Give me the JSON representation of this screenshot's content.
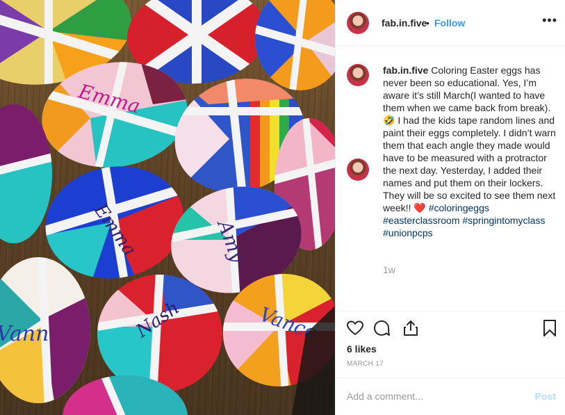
{
  "post": {
    "username": "fab.in.five",
    "separator": "•",
    "follow_label": "Follow",
    "more_icon": "more-options-icon",
    "caption_user": "fab.in.five",
    "caption_part1": " Coloring Easter eggs has never been so educational. Yes, I’m aware it’s still March(I wanted to have them when we came back from break).",
    "caption_emoji": "🤣",
    "caption_part2": " I had the kids tape random lines and paint their eggs completely. I didn’t warn them that each angle they made would have to be measured with a protractor the next day. Yesterday, I added their names and put them on their lockers. They will be so excited to see them next week!! ",
    "caption_heart": "❤️",
    "hashtags": [
      "#coloringeggs",
      "#easterclassroom",
      "#springintomyclass",
      "#unionpcps"
    ],
    "time_ago": "1w",
    "likes": "6 likes",
    "date": "MARCH 17",
    "comment_placeholder": "Add a comment...",
    "post_label": "Post"
  },
  "photo": {
    "names": [
      "Emma",
      "Vann",
      "Vance",
      "Amy",
      "Emma",
      "Nash"
    ]
  },
  "colors": {
    "accent": "#3897f0",
    "post_disabled": "#b2dffc",
    "heart": "#ed4956",
    "hashtag": "#003569"
  }
}
